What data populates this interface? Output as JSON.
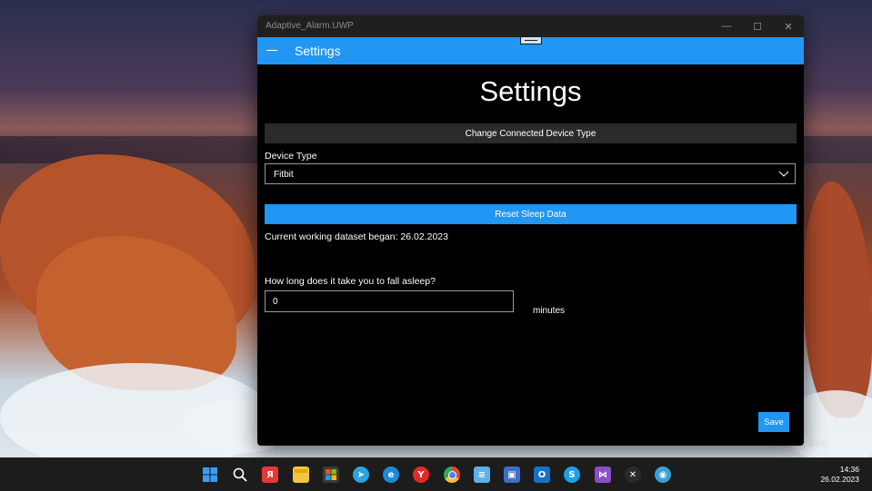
{
  "window": {
    "title": "Adaptive_Alarm.UWP",
    "minimize_glyph": "—",
    "maximize_glyph": "☐",
    "close_glyph": "✕"
  },
  "appbar": {
    "menu_icon": "hamburger-icon",
    "title": "Settings"
  },
  "page": {
    "heading": "Settings",
    "change_device_button": "Change Connected Device Type",
    "device_type_label": "Device Type",
    "device_type_value": "Fitbit",
    "reset_button": "Reset Sleep Data",
    "dataset_text": "Current working dataset began: 26.02.2023",
    "fall_asleep_label": "How long does it take you to fall asleep?",
    "fall_asleep_value": "0",
    "minutes_label": "minutes",
    "save_button": "Save"
  },
  "wallpaper": {
    "watermark": "Microsoft Bing"
  },
  "taskbar": {
    "icons": [
      {
        "name": "windows-start-icon",
        "glyph": "",
        "color": "#2f8ff0"
      },
      {
        "name": "search-icon",
        "glyph": "",
        "color": "transparent"
      },
      {
        "name": "yandex-icon",
        "glyph": "Я",
        "color": "#e53935"
      },
      {
        "name": "file-explorer-icon",
        "glyph": "",
        "color": "#f4c542"
      },
      {
        "name": "microsoft-store-icon",
        "glyph": "",
        "color": "#3a3a3a"
      },
      {
        "name": "telegram-icon",
        "glyph": "➤",
        "color": "#2aa3de"
      },
      {
        "name": "edge-icon",
        "glyph": "e",
        "color": "#1b8ad8"
      },
      {
        "name": "yandex-browser-icon",
        "glyph": "Y",
        "color": "#e32a2a"
      },
      {
        "name": "chrome-icon",
        "glyph": "",
        "color": "#e8b92d"
      },
      {
        "name": "notepad-icon",
        "glyph": "≡",
        "color": "#5fb0e8"
      },
      {
        "name": "save-disk-icon",
        "glyph": "▣",
        "color": "#3c6fc8"
      },
      {
        "name": "outlook-icon",
        "glyph": "O",
        "color": "#1470c8"
      },
      {
        "name": "skype-icon",
        "glyph": "S",
        "color": "#1ea0e6"
      },
      {
        "name": "visual-studio-icon",
        "glyph": "⋈",
        "color": "#8a4fc8"
      },
      {
        "name": "xamarin-icon",
        "glyph": "✕",
        "color": "#2b2b2b"
      },
      {
        "name": "network-globe-icon",
        "glyph": "◉",
        "color": "#3aa0d8"
      }
    ],
    "time": "14:36",
    "date": "26.02.2023"
  }
}
